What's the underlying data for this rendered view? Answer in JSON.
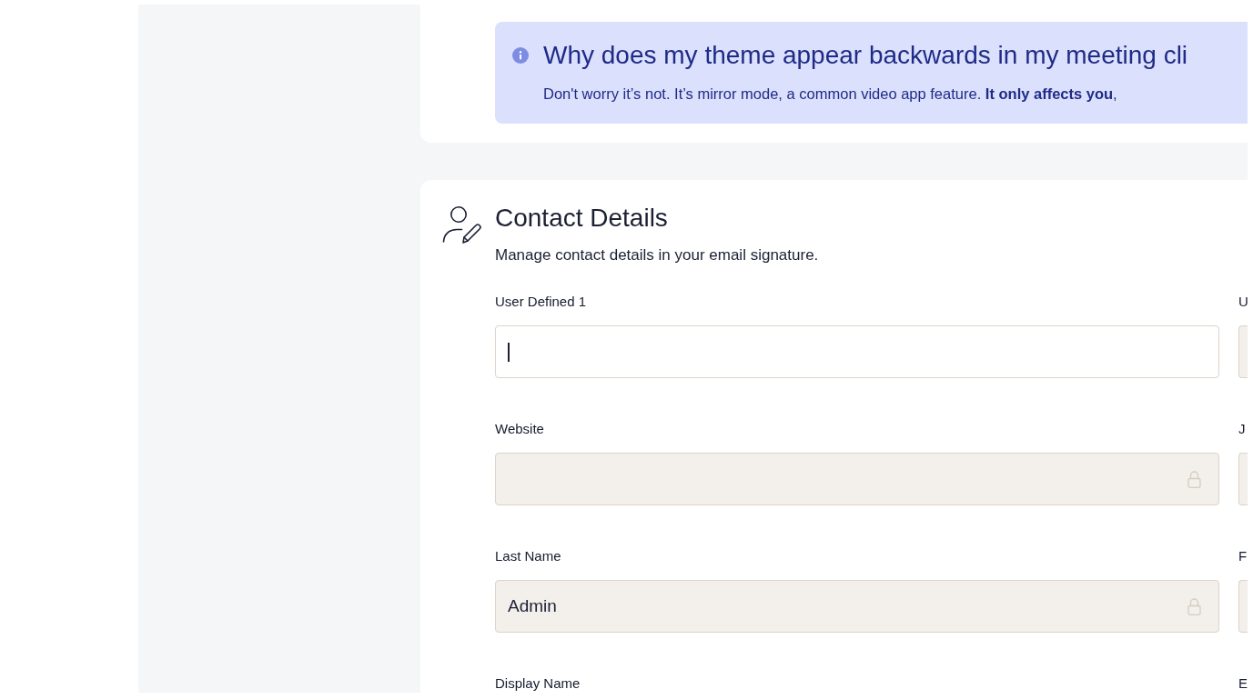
{
  "info_banner": {
    "title": "Why does my theme appear backwards in my meeting cli",
    "text": "Don't worry it’s not. It’s mirror mode, a common video app feature. **It only affects you**,"
  },
  "contact_details": {
    "title": "Contact Details",
    "description": "Manage contact details in your email signature.",
    "fields": [
      {
        "label": "User Defined 1",
        "locked": false,
        "focused": true
      },
      {
        "label": "U",
        "locked": true,
        "focused": false
      },
      {
        "label": "Website",
        "locked": true,
        "focused": false
      },
      {
        "label": "J",
        "locked": true,
        "focused": false
      },
      {
        "label": "Last Name",
        "value": "Admin",
        "locked": true,
        "focused": false
      },
      {
        "label": "F",
        "locked": true,
        "focused": false
      },
      {
        "label": "Display Name"
      },
      {
        "label": "E"
      }
    ]
  }
}
